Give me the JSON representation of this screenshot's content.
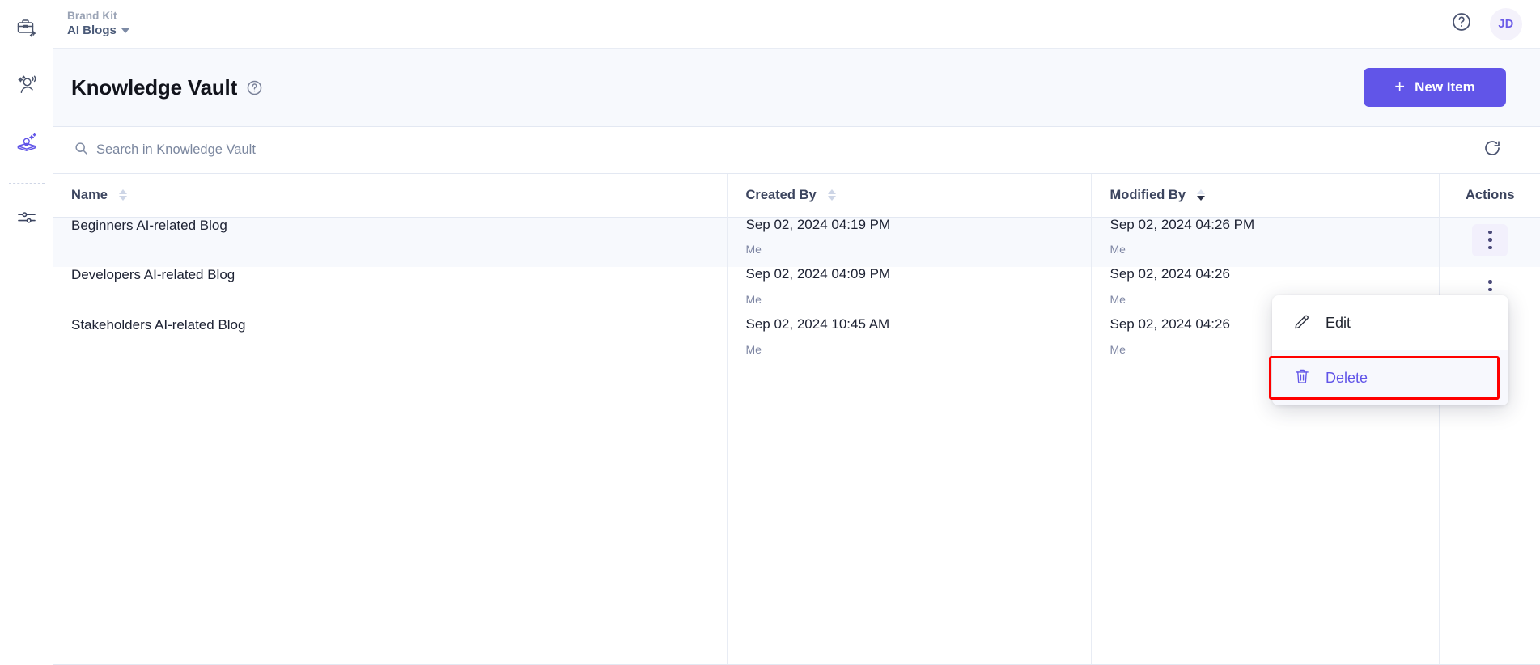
{
  "sidebar": {
    "items": [
      {
        "name": "brand-kit-icon",
        "label": "Brand Kit",
        "active": false
      },
      {
        "name": "audience-icon",
        "label": "Audience",
        "active": false
      },
      {
        "name": "knowledge-vault-icon",
        "label": "Knowledge Vault",
        "active": true
      },
      {
        "name": "settings-sliders-icon",
        "label": "Settings",
        "active": false
      }
    ]
  },
  "topbar": {
    "breadcrumb_parent": "Brand Kit",
    "breadcrumb_current": "AI Blogs",
    "help_icon": "question-circle-icon",
    "avatar_initials": "JD"
  },
  "page": {
    "title": "Knowledge Vault",
    "title_help_icon": "question-circle-icon",
    "new_item_label": "New Item",
    "new_item_plus": "+"
  },
  "search": {
    "icon": "search-icon",
    "placeholder": "Search in Knowledge Vault",
    "value": "",
    "refresh_icon": "refresh-icon"
  },
  "table": {
    "columns": [
      {
        "label": "Name",
        "sortable": true,
        "sort": "none"
      },
      {
        "label": "Created By",
        "sortable": true,
        "sort": "none"
      },
      {
        "label": "Modified By",
        "sortable": true,
        "sort": "desc"
      },
      {
        "label": "Actions",
        "sortable": false,
        "sort": "none"
      }
    ],
    "rows": [
      {
        "name": "Beginners AI-related Blog",
        "created_date": "Sep 02, 2024 04:19 PM",
        "created_by": "Me",
        "modified_date": "Sep 02, 2024 04:26 PM",
        "modified_by": "Me",
        "actions_icon": "kebab-menu-icon",
        "highlighted": true
      },
      {
        "name": "Developers AI-related Blog",
        "created_date": "Sep 02, 2024 04:09 PM",
        "created_by": "Me",
        "modified_date": "Sep 02, 2024 04:26",
        "modified_by": "Me",
        "actions_icon": "kebab-menu-icon",
        "highlighted": false
      },
      {
        "name": "Stakeholders AI-related Blog",
        "created_date": "Sep 02, 2024 10:45 AM",
        "created_by": "Me",
        "modified_date": "Sep 02, 2024 04:26",
        "modified_by": "Me",
        "actions_icon": "kebab-menu-icon",
        "highlighted": false
      }
    ]
  },
  "context_menu": {
    "edit_label": "Edit",
    "edit_icon": "pencil-icon",
    "delete_label": "Delete",
    "delete_icon": "trash-icon"
  },
  "colors": {
    "accent": "#6155e8",
    "page_header_bg": "#f7f9fd",
    "row_highlight": "#f7f9fd",
    "annotation": "#ff0000",
    "muted_text": "#7f87a4"
  }
}
